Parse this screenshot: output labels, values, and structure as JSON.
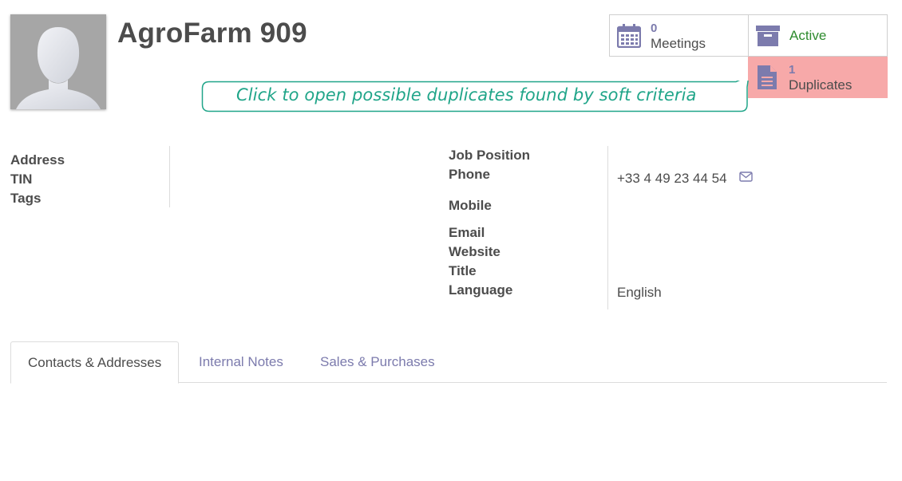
{
  "partner": {
    "name": "AgroFarm 909",
    "avatar_icon": "person-placeholder-icon"
  },
  "smart_buttons": {
    "meetings": {
      "count": "0",
      "label": "Meetings",
      "icon": "calendar-icon"
    },
    "active": {
      "label": "Active",
      "icon": "archive-icon"
    },
    "duplicates": {
      "count": "1",
      "label": "Duplicates",
      "icon": "document-icon",
      "color": "#f7a9a9"
    }
  },
  "tooltip": {
    "text": "Click to open possible duplicates found by soft criteria",
    "color": "#20a589"
  },
  "left_group": {
    "address_label": "Address",
    "tin_label": "TIN",
    "tags_label": "Tags"
  },
  "right_group": {
    "job_position_label": "Job Position",
    "phone_label": "Phone",
    "phone_value": "+33 4 49 23 44 54",
    "mobile_label": "Mobile",
    "email_label": "Email",
    "website_label": "Website",
    "title_label": "Title",
    "language_label": "Language",
    "language_value": "English"
  },
  "tabs": [
    {
      "label": "Contacts & Addresses",
      "active": true
    },
    {
      "label": "Internal Notes",
      "active": false
    },
    {
      "label": "Sales & Purchases",
      "active": false
    }
  ],
  "colors": {
    "accent": "#7c7bad",
    "active_green": "#2e8b2e",
    "duplicate_bg": "#f7a9a9"
  }
}
